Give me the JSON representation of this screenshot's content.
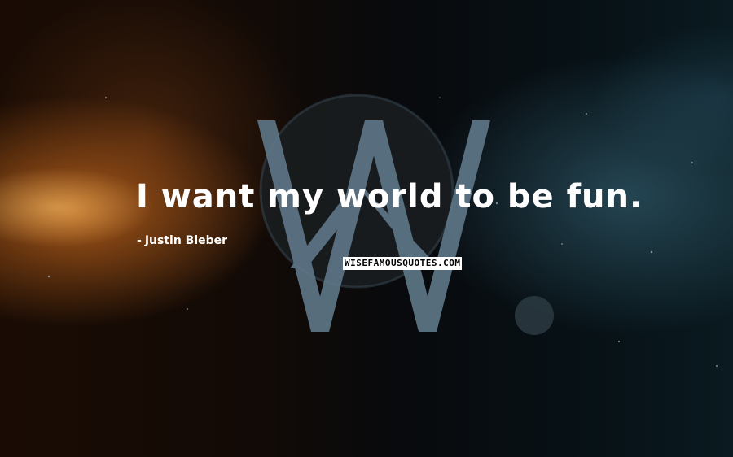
{
  "quote": {
    "text": "I want my world to be fun.",
    "author_prefix": "-",
    "author": "Justin Bieber"
  },
  "watermark": "WISEFAMOUSQUOTES.COM",
  "colors": {
    "text": "#ffffff",
    "logo": "#5f7889",
    "glow_warm": "#d2701e",
    "glow_cool": "#3c6e82"
  },
  "icons": [
    "alan-walker-logo-icon",
    "planet-icon",
    "moon-icon"
  ]
}
